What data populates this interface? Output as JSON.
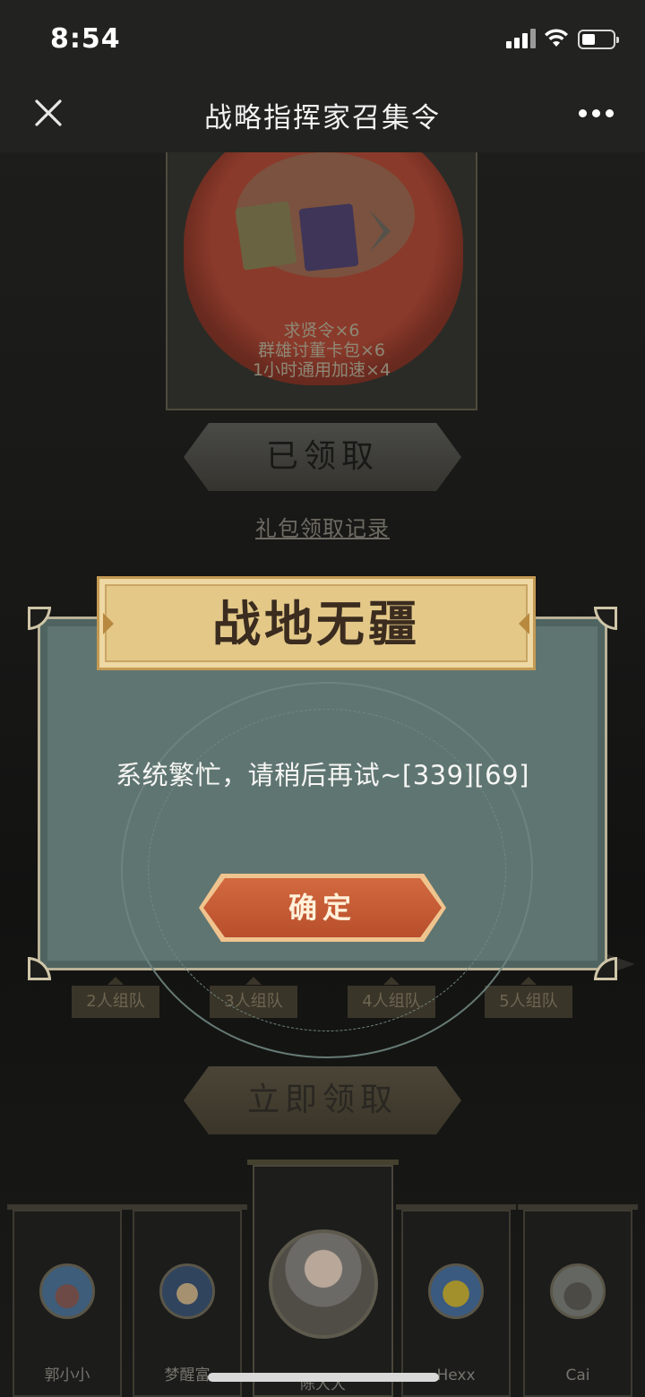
{
  "status_bar": {
    "time": "8:54"
  },
  "nav": {
    "title": "战略指挥家召集令"
  },
  "gift": {
    "items": [
      "求贤令×6",
      "群雄讨董卡包×6",
      "1小时通用加速×4"
    ],
    "claimed_label": "已领取",
    "record_link": "礼包领取记录"
  },
  "teams": [
    "2人组队",
    "3人组队",
    "4人组队",
    "5人组队"
  ],
  "claim_button": "立即领取",
  "members": [
    "郭小小",
    "梦醒富",
    "陈大大",
    "Hexx",
    "Cai"
  ],
  "dialog": {
    "title": "战地无疆",
    "message": "系统繁忙，请稍后再试~[339][69]",
    "confirm": "确定"
  },
  "colors": {
    "dialog_body": "#5f7571",
    "dialog_header": "#e3c888",
    "confirm_button": "#c95b34"
  }
}
